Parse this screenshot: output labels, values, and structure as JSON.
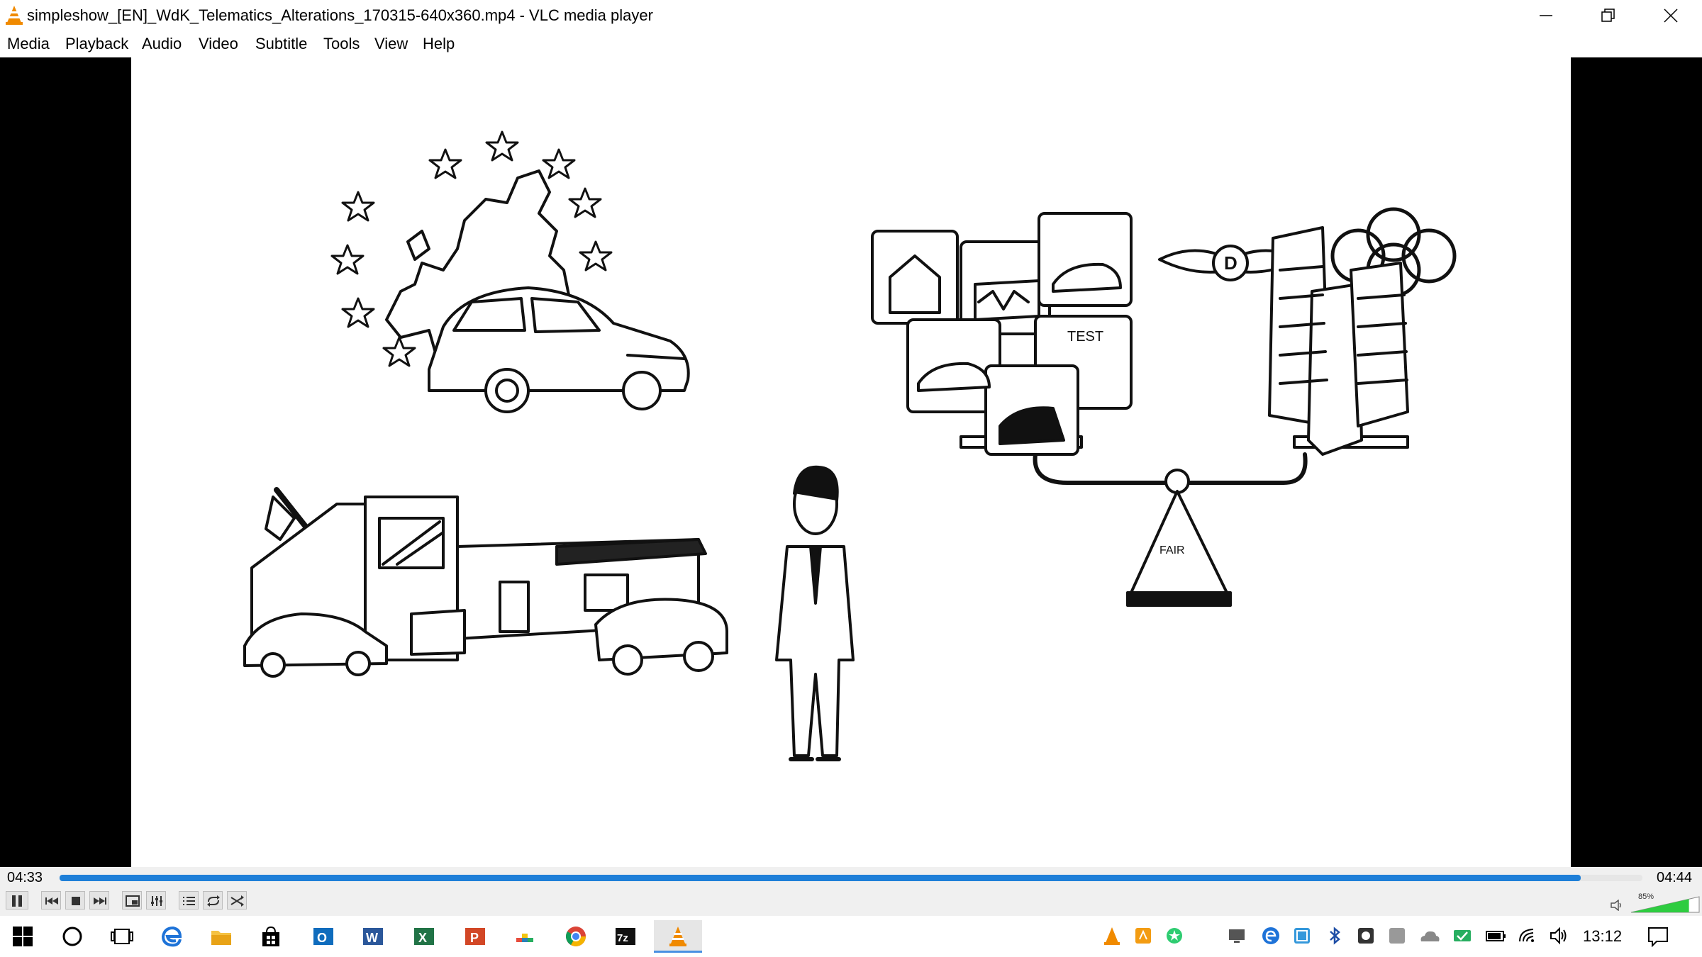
{
  "window": {
    "title": "simpleshow_[EN]_WdK_Telematics_Alterations_170315-640x360.mp4 - VLC media player",
    "app_icon": "vlc-cone-icon"
  },
  "menu": {
    "items": [
      "Media",
      "Playback",
      "Audio",
      "Video",
      "Subtitle",
      "Tools",
      "View",
      "Help"
    ]
  },
  "video_scene": {
    "sign_text": "TEST",
    "scale_base_text": "FAIR",
    "wings_letter": "D"
  },
  "controls": {
    "elapsed": "04:33",
    "total": "04:44",
    "progress_fraction": 0.961,
    "volume_label": "85%",
    "volume_fraction": 0.85,
    "buttons": [
      "pause-icon",
      "previous-icon",
      "stop-icon",
      "next-icon",
      "fullscreen-icon",
      "extended-settings-icon",
      "playlist-icon",
      "loop-icon",
      "shuffle-icon"
    ]
  },
  "taskbar": {
    "clock": "13:12",
    "apps": [
      "start-icon",
      "cortana-icon",
      "task-view-icon",
      "edge-icon",
      "file-explorer-icon",
      "store-icon",
      "outlook-icon",
      "word-icon",
      "excel-icon",
      "powerpoint-icon",
      "app-icon",
      "chrome-icon",
      "7zip-icon",
      "vlc-icon"
    ],
    "app_labels": {
      "outlook": "O",
      "word": "W",
      "excel": "X",
      "powerpoint": "P",
      "sevenzip": "7z"
    },
    "tray": [
      "vlc-tray-icon",
      "app-tray-icon",
      "app-tray-icon-2",
      "monitor-icon",
      "edge-tray-icon",
      "app-tray-icon-3",
      "bluetooth-icon",
      "app-tray-icon-4",
      "app-tray-icon-5",
      "onedrive-icon",
      "defender-icon",
      "battery-icon",
      "wifi-icon",
      "speaker-icon"
    ],
    "colors": {
      "accent": "#4a90e2",
      "seek": "#1e7fd8",
      "vlc": "#f08a00",
      "volume": "#2ecc40"
    }
  }
}
